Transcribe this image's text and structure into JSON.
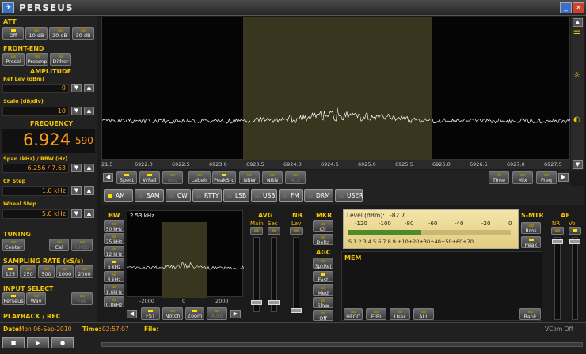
{
  "app": {
    "title": "PERSEUS"
  },
  "att": {
    "label": "ATT",
    "buttons": [
      "Off",
      "10 dB",
      "20 dB",
      "30 dB"
    ]
  },
  "frontend": {
    "label": "FRONT-END",
    "buttons": [
      "Presel",
      "Preamp",
      "Dither"
    ]
  },
  "amplitude": {
    "label": "AMPLITUDE",
    "ref_label": "Ref Lev (dBm)",
    "ref_value": "0",
    "scale_label": "Scale (dB/div)",
    "scale_value": "10"
  },
  "frequency": {
    "label": "FREQUENCY",
    "main": "6.924",
    "sub": "590",
    "span_label": "Span (kHz) / RBW (Hz)",
    "span_value": "6.256 / 7.63",
    "cf_label": "CF Step",
    "cf_value": "1.0 kHz",
    "wheel_label": "Wheel Step",
    "wheel_value": "5.0 kHz"
  },
  "tuning": {
    "label": "TUNING",
    "buttons": [
      "Center",
      "Cal",
      "Undo"
    ]
  },
  "sampling": {
    "label": "SAMPLING RATE (kS/s)",
    "buttons": [
      "125",
      "250",
      "500",
      "1000",
      "2000"
    ]
  },
  "input": {
    "label": "INPUT SELECT",
    "buttons": [
      "Perseus",
      "Wav",
      "File"
    ]
  },
  "playback": {
    "label": "PLAYBACK / REC",
    "date_label": "Date:",
    "date": "Mon 06-Sep-2010",
    "time_label": "Time:",
    "time": "02:57:07",
    "file_label": "File:",
    "vcom": "VCom Off"
  },
  "spectrum": {
    "ticks": [
      "21.5",
      "6922.0",
      "6922.5",
      "6923.0",
      "6923.5",
      "6924.0",
      "6924.5",
      "6925.0",
      "6925.5",
      "6926.0",
      "6926.5",
      "6927.0",
      "6927.5"
    ],
    "buttons_left": [
      "Spect",
      "WFall",
      "Avg",
      "Labels",
      "PeakSrc",
      "NBW",
      "NBN",
      "ALL"
    ],
    "buttons_right": [
      "Time",
      "Mix",
      "Freq"
    ]
  },
  "modes": [
    "AM",
    "SAM",
    "CW",
    "RTTY",
    "LSB",
    "USB",
    "FM",
    "DRM",
    "USER"
  ],
  "bw": {
    "label": "BW",
    "buttons": [
      "50 kHz",
      "25 kHz",
      "12 kHz",
      "6 kHz",
      "3 kHz",
      "1.6kHz",
      "0.8kHz"
    ],
    "readout": "2.53 kHz",
    "ticks": [
      "-2000",
      "0",
      "2000"
    ],
    "buttons_bottom": [
      "FST",
      "Notch",
      "Zoom",
      "Auto"
    ]
  },
  "avg": {
    "label": "AVG",
    "main": "Main",
    "sec": "Sec"
  },
  "nb": {
    "label": "NB",
    "lev": "Lev"
  },
  "mkr": {
    "label": "MKR",
    "buttons": [
      "Clr",
      "Delta"
    ]
  },
  "agc": {
    "label": "AGC",
    "buttons": [
      "SpkRej",
      "Fast",
      "Med",
      "Slow",
      "Off"
    ]
  },
  "smeter": {
    "level_label": "Level (dBm):",
    "level_value": "-82.7",
    "top_scale": [
      "-120",
      "-100",
      "-80",
      "-60",
      "-40",
      "-20",
      "0"
    ],
    "bottom_scale": "S 1 2 3 4 5 6 7 8 9 +10+20+30+40+50+60+70",
    "label": "S-MTR",
    "buttons": [
      "Rms",
      "Peak"
    ],
    "level_fraction": 0.45
  },
  "af": {
    "label": "AF",
    "nr": "NR",
    "vol": "Vol"
  },
  "mem": {
    "label": "MEM",
    "buttons": [
      "HFCC",
      "EIBI",
      "User",
      "ALL"
    ],
    "bank": "Bank"
  }
}
